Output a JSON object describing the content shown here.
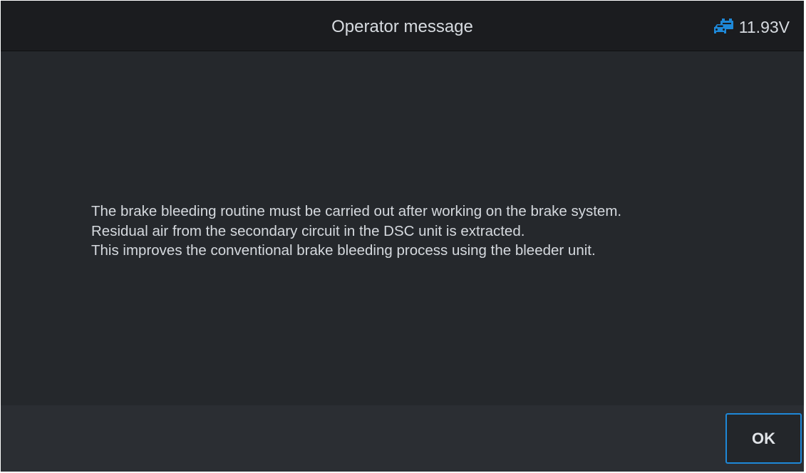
{
  "header": {
    "title": "Operator message",
    "battery_icon": "car-battery-icon",
    "voltage": "11.93V",
    "accent_color": "#1e88d8"
  },
  "message": {
    "lines": [
      "The brake bleeding routine must be carried out after working on the brake system.",
      "Residual air from the secondary circuit in the DSC unit is extracted.",
      "This improves the conventional brake bleeding process using the bleeder unit."
    ]
  },
  "footer": {
    "ok_label": "OK"
  }
}
